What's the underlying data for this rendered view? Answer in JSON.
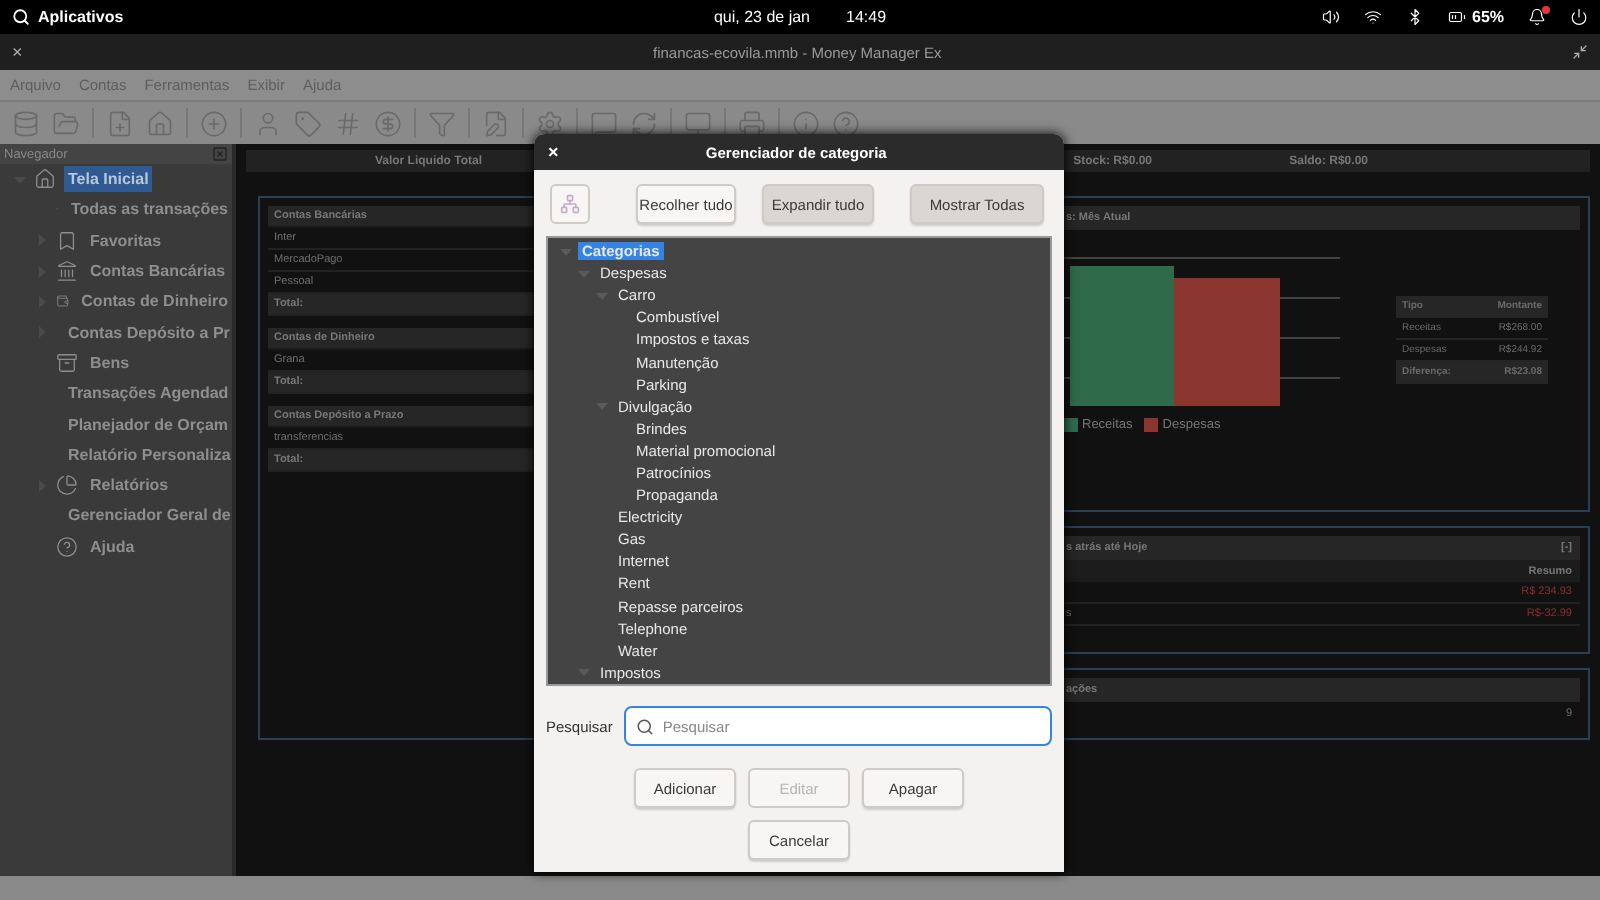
{
  "top_bar": {
    "apps_label": "Aplicativos",
    "date": "qui, 23 de jan",
    "time": "14:49",
    "battery": "65%"
  },
  "window": {
    "close": "×",
    "title": "financas-ecovila.mmb - Money Manager Ex"
  },
  "menu": [
    "Arquivo",
    "Contas",
    "Ferramentas",
    "Exibir",
    "Ajuda"
  ],
  "navigator": {
    "title": "Navegador",
    "items": [
      {
        "label": "Tela Inicial",
        "selected": true,
        "expanded": true,
        "children": [
          {
            "label": "Todas as transações",
            "selected": false,
            "expandable": false
          },
          {
            "label": "Favoritas",
            "selected": false,
            "expandable": true
          },
          {
            "label": "Contas Bancárias",
            "selected": false,
            "expandable": true
          },
          {
            "label": "Contas de Dinheiro",
            "selected": false,
            "expandable": true
          },
          {
            "label": "Contas Depósito a Pr",
            "selected": false,
            "expandable": true
          },
          {
            "label": "Bens",
            "selected": false,
            "expandable": false
          },
          {
            "label": "Transações Agendad",
            "selected": false,
            "expandable": false
          },
          {
            "label": "Planejador de Orçam",
            "selected": false,
            "expandable": false
          },
          {
            "label": "Relatório Personaliza",
            "selected": false,
            "expandable": false
          },
          {
            "label": "Relatórios",
            "selected": false,
            "expandable": true
          },
          {
            "label": "Gerenciador Geral de",
            "selected": false,
            "expandable": false
          },
          {
            "label": "Ajuda",
            "selected": false,
            "expandable": false
          }
        ]
      }
    ]
  },
  "summary_bar": {
    "net_total": "Valor Liquido Total",
    "stock": "Stock: R$0.00",
    "balance": "Saldo: R$0.00"
  },
  "account_groups": [
    {
      "title": "Contas Bancárias",
      "rows": [
        "Inter",
        "MercadoPago",
        "Pessoal"
      ],
      "total": "Total:"
    },
    {
      "title": "Contas de Dinheiro",
      "rows": [
        "Grana"
      ],
      "total": "Total:"
    },
    {
      "title": "Contas Depósito a Prazo",
      "rows": [
        "transferencias"
      ],
      "total": "Total:"
    }
  ],
  "income_card": {
    "title": "s: Mês Atual",
    "legend": [
      {
        "label": "Receitas",
        "color": "#2f6a4b"
      },
      {
        "label": "Despesas",
        "color": "#8a352e"
      }
    ],
    "table": {
      "columns": [
        "Tipo",
        "Montante"
      ],
      "rows": [
        [
          "Receitas",
          "R$268.00"
        ],
        [
          "Despesas",
          "R$244.92"
        ]
      ],
      "total": [
        "Diferença:",
        "R$23.08"
      ]
    }
  },
  "period_card": {
    "title": "s atrás até Hoje",
    "toggle": "[-]",
    "column": "Resumo",
    "rows": [
      {
        "value": "R$ 234.93"
      },
      {
        "label": "s",
        "value": "R$-32.99"
      }
    ]
  },
  "transactions_card": {
    "title": "ações",
    "value": "9"
  },
  "dialog": {
    "close": "×",
    "title": "Gerenciador de categoria",
    "toolbar": [
      {
        "kind": "icon",
        "disabled": true
      },
      {
        "kind": "text",
        "label": "Recolher tudo",
        "pressed": false
      },
      {
        "kind": "text",
        "label": "Expandir tudo",
        "pressed": true
      },
      {
        "kind": "text",
        "label": "Mostrar Todas",
        "pressed": true
      }
    ],
    "tree": [
      {
        "label": "Categorias",
        "selected": true,
        "expanded": true,
        "children": [
          {
            "label": "Despesas",
            "selected": false,
            "expanded": true,
            "children": [
              {
                "label": "Carro",
                "selected": false,
                "expanded": true,
                "children": [
                  {
                    "label": "Combustível",
                    "selected": false
                  },
                  {
                    "label": "Impostos e taxas",
                    "selected": false
                  },
                  {
                    "label": "Manutenção",
                    "selected": false
                  },
                  {
                    "label": "Parking",
                    "selected": false
                  }
                ]
              },
              {
                "label": "Divulgação",
                "selected": false,
                "expanded": true,
                "children": [
                  {
                    "label": "Brindes",
                    "selected": false
                  },
                  {
                    "label": "Material promocional",
                    "selected": false
                  },
                  {
                    "label": "Patrocínios",
                    "selected": false
                  },
                  {
                    "label": "Propaganda",
                    "selected": false
                  }
                ]
              },
              {
                "label": "Electricity",
                "selected": false
              },
              {
                "label": "Gas",
                "selected": false
              },
              {
                "label": "Internet",
                "selected": false
              },
              {
                "label": "Rent",
                "selected": false
              },
              {
                "label": "Repasse parceiros",
                "selected": false
              },
              {
                "label": "Telephone",
                "selected": false
              },
              {
                "label": "Water",
                "selected": false
              }
            ]
          },
          {
            "label": "Impostos",
            "selected": false,
            "expanded": true
          }
        ]
      }
    ],
    "search": {
      "label": "Pesquisar",
      "placeholder": "Pesquisar"
    },
    "actions": [
      {
        "label": "Adicionar",
        "disabled": false
      },
      {
        "label": "Editar",
        "disabled": true
      },
      {
        "label": "Apagar",
        "disabled": false
      }
    ],
    "cancel": "Cancelar"
  }
}
